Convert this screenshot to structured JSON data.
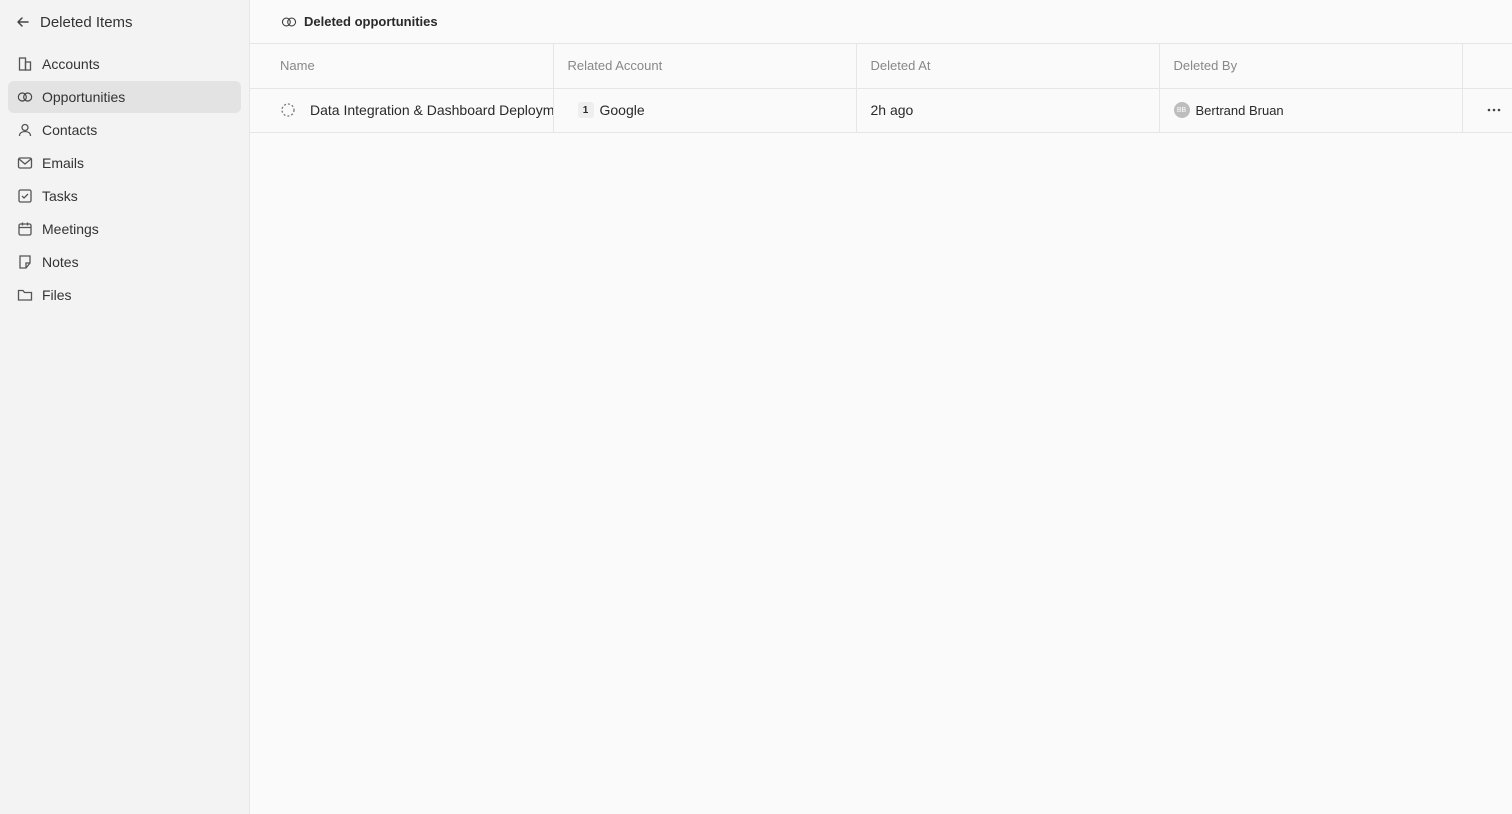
{
  "sidebar": {
    "title": "Deleted Items",
    "items": [
      {
        "label": "Accounts",
        "icon": "building-icon"
      },
      {
        "label": "Opportunities",
        "icon": "opportunities-icon",
        "active": true
      },
      {
        "label": "Contacts",
        "icon": "person-icon"
      },
      {
        "label": "Emails",
        "icon": "mail-icon"
      },
      {
        "label": "Tasks",
        "icon": "checkbox-icon"
      },
      {
        "label": "Meetings",
        "icon": "calendar-icon"
      },
      {
        "label": "Notes",
        "icon": "note-icon"
      },
      {
        "label": "Files",
        "icon": "folder-icon"
      }
    ]
  },
  "main": {
    "title": "Deleted opportunities",
    "columns": [
      "Name",
      "Related Account",
      "Deleted At",
      "Deleted By"
    ],
    "rows": [
      {
        "name": "Data Integration & Dashboard Deployment",
        "account": "Google",
        "account_logo": "1",
        "deleted_at": "2h ago",
        "deleted_by": "Bertrand Bruan",
        "deleted_by_initials": "BB"
      }
    ]
  }
}
